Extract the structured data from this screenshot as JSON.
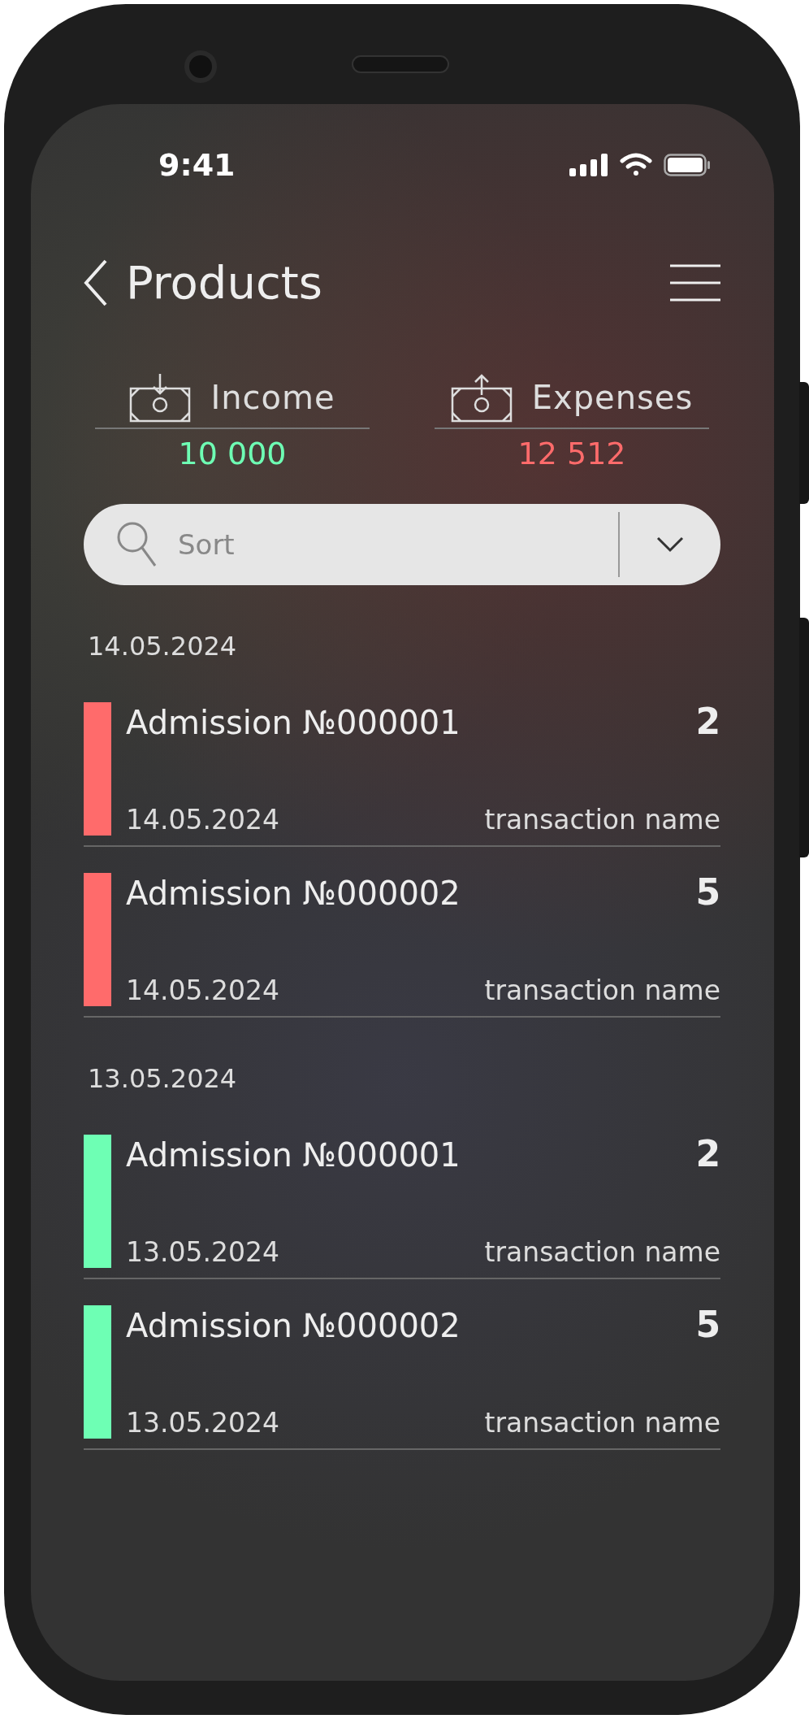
{
  "status_bar": {
    "time": "9:41"
  },
  "header": {
    "title": "Products"
  },
  "summary": [
    {
      "kind": "income",
      "label": "Income",
      "value": "10 000"
    },
    {
      "kind": "expense",
      "label": "Expenses",
      "value": "12 512"
    }
  ],
  "search": {
    "placeholder": "Sort"
  },
  "groups": [
    {
      "date": "14.05.2024",
      "rows": [
        {
          "title": "Admission №000001",
          "count": "2",
          "date": "14.05.2024",
          "transaction": "transaction name",
          "color": "#ff6b6b"
        },
        {
          "title": "Admission №000002",
          "count": "5",
          "date": "14.05.2024",
          "transaction": "transaction name",
          "color": "#ff6b6b"
        }
      ]
    },
    {
      "date": "13.05.2024",
      "rows": [
        {
          "title": "Admission №000001",
          "count": "2",
          "date": "13.05.2024",
          "transaction": "transaction name",
          "color": "#6effb4"
        },
        {
          "title": "Admission №000002",
          "count": "5",
          "date": "13.05.2024",
          "transaction": "transaction name",
          "color": "#6effb4"
        }
      ]
    }
  ]
}
